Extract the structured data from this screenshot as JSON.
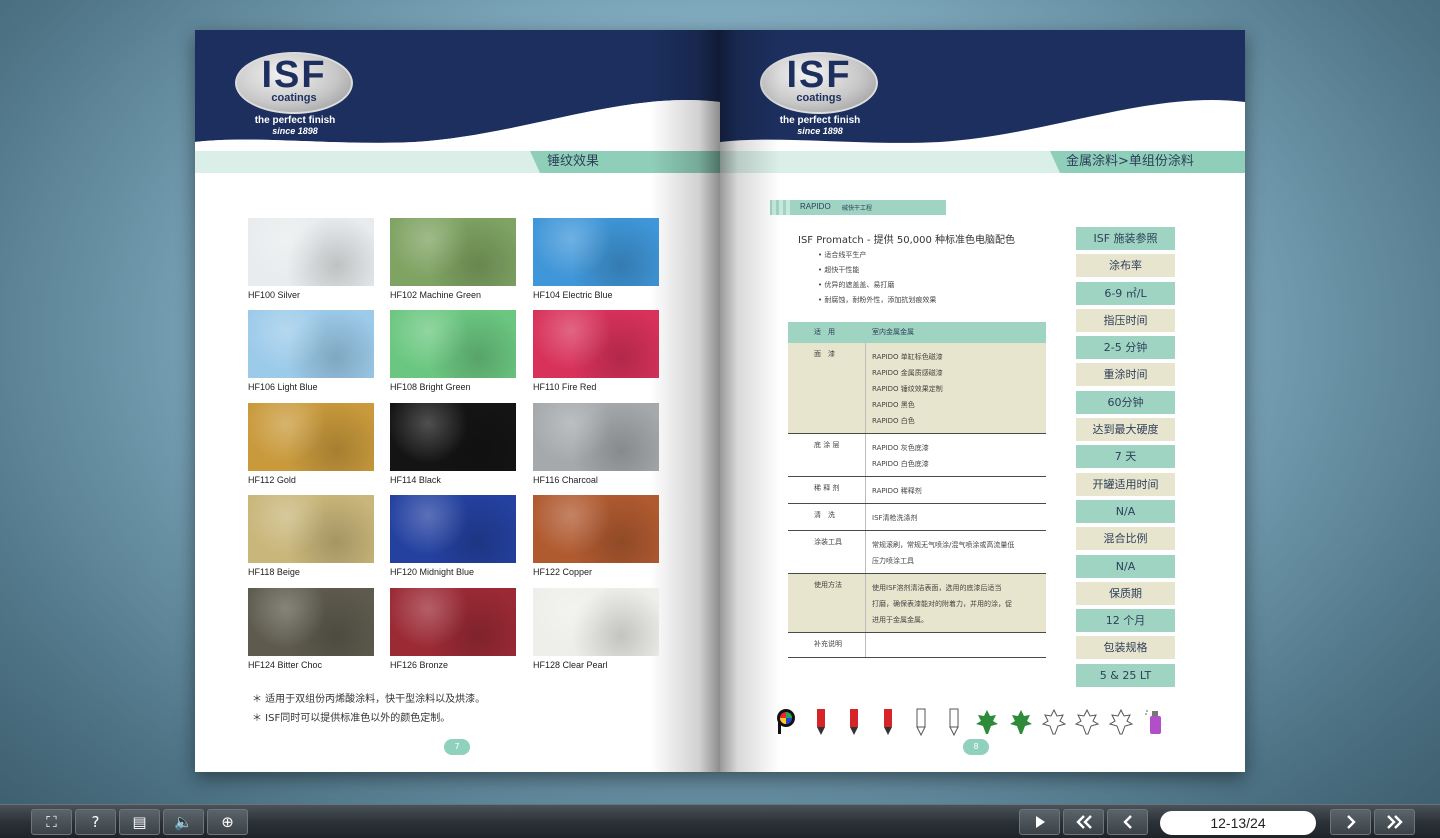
{
  "brand": {
    "logo_text": "ISF",
    "logo_sub": "coatings",
    "tagline": "the perfect finish",
    "since": "since 1898"
  },
  "left_page": {
    "section_title": "锤纹效果",
    "swatches": [
      {
        "label": "HF100 Silver",
        "color": "#e9ecee"
      },
      {
        "label": "HF102 Machine Green",
        "color": "#7ea362"
      },
      {
        "label": "HF104 Electric Blue",
        "color": "#3f96d8"
      },
      {
        "label": "HF106 Light Blue",
        "color": "#9ccbea"
      },
      {
        "label": "HF108 Bright Green",
        "color": "#6bc780"
      },
      {
        "label": "HF110 Fire Red",
        "color": "#d8315a"
      },
      {
        "label": "HF112 Gold",
        "color": "#c99a3c"
      },
      {
        "label": "HF114 Black",
        "color": "#141414"
      },
      {
        "label": "HF116 Charcoal",
        "color": "#a5a9ac"
      },
      {
        "label": "HF118 Beige",
        "color": "#c9b67a"
      },
      {
        "label": "HF120 Midnight Blue",
        "color": "#2441a0"
      },
      {
        "label": "HF122 Copper",
        "color": "#b05a30"
      },
      {
        "label": "HF124 Bitter Choc",
        "color": "#5e5b4e"
      },
      {
        "label": "HF126 Bronze",
        "color": "#9b2a35"
      },
      {
        "label": "HF128 Clear Pearl",
        "color": "#eeeeea"
      }
    ],
    "notes": [
      "＊ 适用于双组份丙烯酸涂料，快干型涂料以及烘漆。",
      "＊ ISF同时可以提供标准色以外的颜色定制。"
    ],
    "page_number": "7"
  },
  "right_page": {
    "section_title": "金属涂料>单组份涂料",
    "product_code": "RAPIDO",
    "product_sub": "碱快干工程",
    "promatch": "ISF Promatch - 提供 50,000 种标准色电脑配色",
    "bullets": [
      "适合线平生产",
      "超快干性能",
      "优异的遮盖盖、易打磨",
      "耐腐蚀，耐粉外性，添加抗划痕效果"
    ],
    "spec_header": {
      "key": "适　用",
      "value": "室内金属金属"
    },
    "spec_rows": [
      {
        "key": "面　漆",
        "value": "RAPIDO 单缸标色磁漆\nRAPIDO 金属质感磁漆\nRAPIDO 锤纹效果定制\nRAPIDO 黑色\nRAPIDO 白色",
        "tan": true
      },
      {
        "key": "底 涂 层",
        "value": "RAPIDO 灰色底漆\nRAPIDO 白色底漆",
        "tan": false
      },
      {
        "key": "稀 释 剂",
        "value": "RAPIDO 稀释剂",
        "tan": false
      },
      {
        "key": "清　洗",
        "value": "ISF清枪洗涤剂",
        "tan": false
      },
      {
        "key": "涂装工具",
        "value": "常规滚刷，常规无气喷涂/混气喷涂或高流量低\n压力喷涂工具",
        "tan": false
      },
      {
        "key": "使用方法",
        "value": "使用ISF溶剂清洁表面，选用的底漆后适当\n打磨，确保表漆能对的附着力，并用的涂，促\n进用于金属金属。",
        "tan": true
      },
      {
        "key": "补充说明",
        "value": "",
        "tan": false
      }
    ],
    "reference": [
      {
        "text": "ISF 施装参照",
        "style": "green"
      },
      {
        "text": "涂布率",
        "style": "tan"
      },
      {
        "text": "6-9 ㎡/L",
        "style": "green"
      },
      {
        "text": "指压时间",
        "style": "tan"
      },
      {
        "text": "2-5 分钟",
        "style": "green"
      },
      {
        "text": "重涂时间",
        "style": "tan"
      },
      {
        "text": "60分钟",
        "style": "green"
      },
      {
        "text": "达到最大硬度",
        "style": "tan"
      },
      {
        "text": "7 天",
        "style": "green"
      },
      {
        "text": "开罐适用时间",
        "style": "tan"
      },
      {
        "text": "N/A",
        "style": "green"
      },
      {
        "text": "混合比例",
        "style": "tan"
      },
      {
        "text": "N/A",
        "style": "green"
      },
      {
        "text": "保质期",
        "style": "tan"
      },
      {
        "text": "12 个月",
        "style": "green"
      },
      {
        "text": "包装规格",
        "style": "tan"
      },
      {
        "text": "5 & 25 LT",
        "style": "green"
      }
    ],
    "icons": [
      "palette-icon",
      "red-pencil-icon",
      "red-pencil-icon",
      "red-pencil-icon",
      "outline-pencil-icon",
      "outline-pencil-icon",
      "green-leaf-icon",
      "green-leaf-icon",
      "outline-leaf-icon",
      "outline-leaf-icon",
      "outline-leaf-icon",
      "spray-can-icon"
    ],
    "page_number": "8"
  },
  "toolbar": {
    "buttons_left": [
      {
        "name": "fullscreen-button",
        "icon": "fullscreen-icon",
        "glyph": "⛶"
      },
      {
        "name": "help-button",
        "icon": "help-icon",
        "glyph": "?"
      },
      {
        "name": "contents-button",
        "icon": "document-icon",
        "glyph": "▤"
      },
      {
        "name": "sound-button",
        "icon": "speaker-icon",
        "glyph": "🔈"
      },
      {
        "name": "zoom-button",
        "icon": "zoom-in-icon",
        "glyph": "⊕"
      }
    ],
    "page_indicator": "12-13/24"
  },
  "colors": {
    "navy": "#1c2f5e",
    "mint": "#9fd4c2",
    "tan": "#e8e5ce"
  }
}
